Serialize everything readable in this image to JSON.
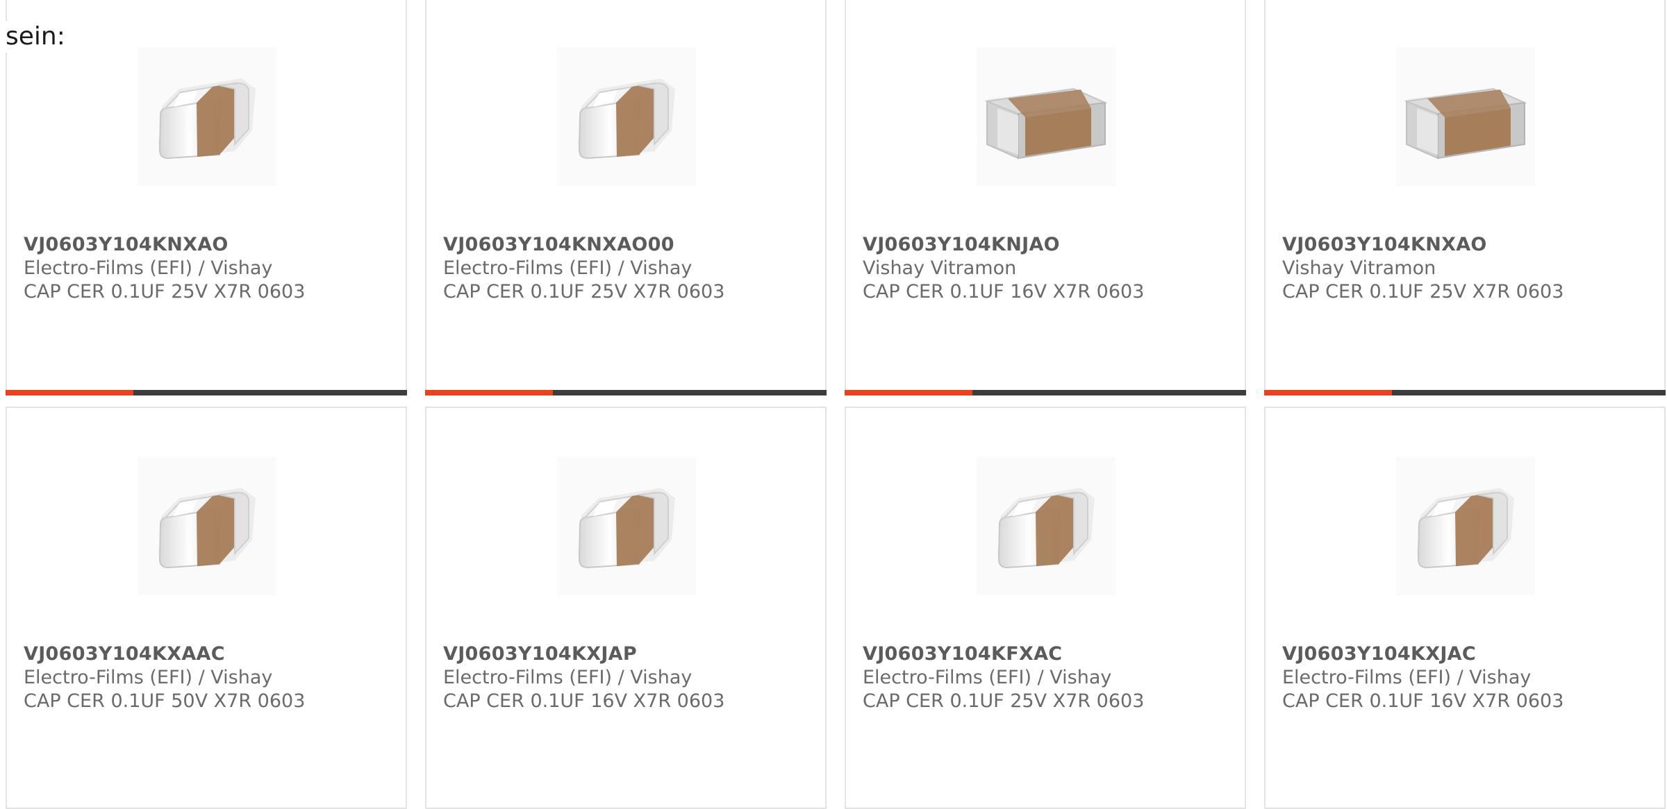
{
  "intro_text": "sein:",
  "colors": {
    "accent": "#e8431d",
    "bar": "#3c3c3c",
    "border": "#e3e3e3",
    "ceramic_body": "#a77e5a"
  },
  "products": [
    {
      "part": "VJ0603Y104KNXAO",
      "manufacturer": "Electro-Films (EFI) / Vishay",
      "description": "CAP CER 0.1UF 25V X7R 0603",
      "image_icon": "capacitor-chip-icon"
    },
    {
      "part": "VJ0603Y104KNXAO00",
      "manufacturer": "Electro-Films (EFI) / Vishay",
      "description": "CAP CER 0.1UF 25V X7R 0603",
      "image_icon": "capacitor-chip-icon"
    },
    {
      "part": "VJ0603Y104KNJAO",
      "manufacturer": "Vishay Vitramon",
      "description": "CAP CER 0.1UF 16V X7R 0603",
      "image_icon": "capacitor-chip-large-icon"
    },
    {
      "part": "VJ0603Y104KNXAO",
      "manufacturer": "Vishay Vitramon",
      "description": "CAP CER 0.1UF 25V X7R 0603",
      "image_icon": "capacitor-chip-large-icon"
    },
    {
      "part": "VJ0603Y104KXAAC",
      "manufacturer": "Electro-Films (EFI) / Vishay",
      "description": "CAP CER 0.1UF 50V X7R 0603",
      "image_icon": "capacitor-chip-icon"
    },
    {
      "part": "VJ0603Y104KXJAP",
      "manufacturer": "Electro-Films (EFI) / Vishay",
      "description": "CAP CER 0.1UF 16V X7R 0603",
      "image_icon": "capacitor-chip-icon"
    },
    {
      "part": "VJ0603Y104KFXAC",
      "manufacturer": "Electro-Films (EFI) / Vishay",
      "description": "CAP CER 0.1UF 25V X7R 0603",
      "image_icon": "capacitor-chip-icon"
    },
    {
      "part": "VJ0603Y104KXJAC",
      "manufacturer": "Electro-Films (EFI) / Vishay",
      "description": "CAP CER 0.1UF 16V X7R 0603",
      "image_icon": "capacitor-chip-icon"
    }
  ]
}
